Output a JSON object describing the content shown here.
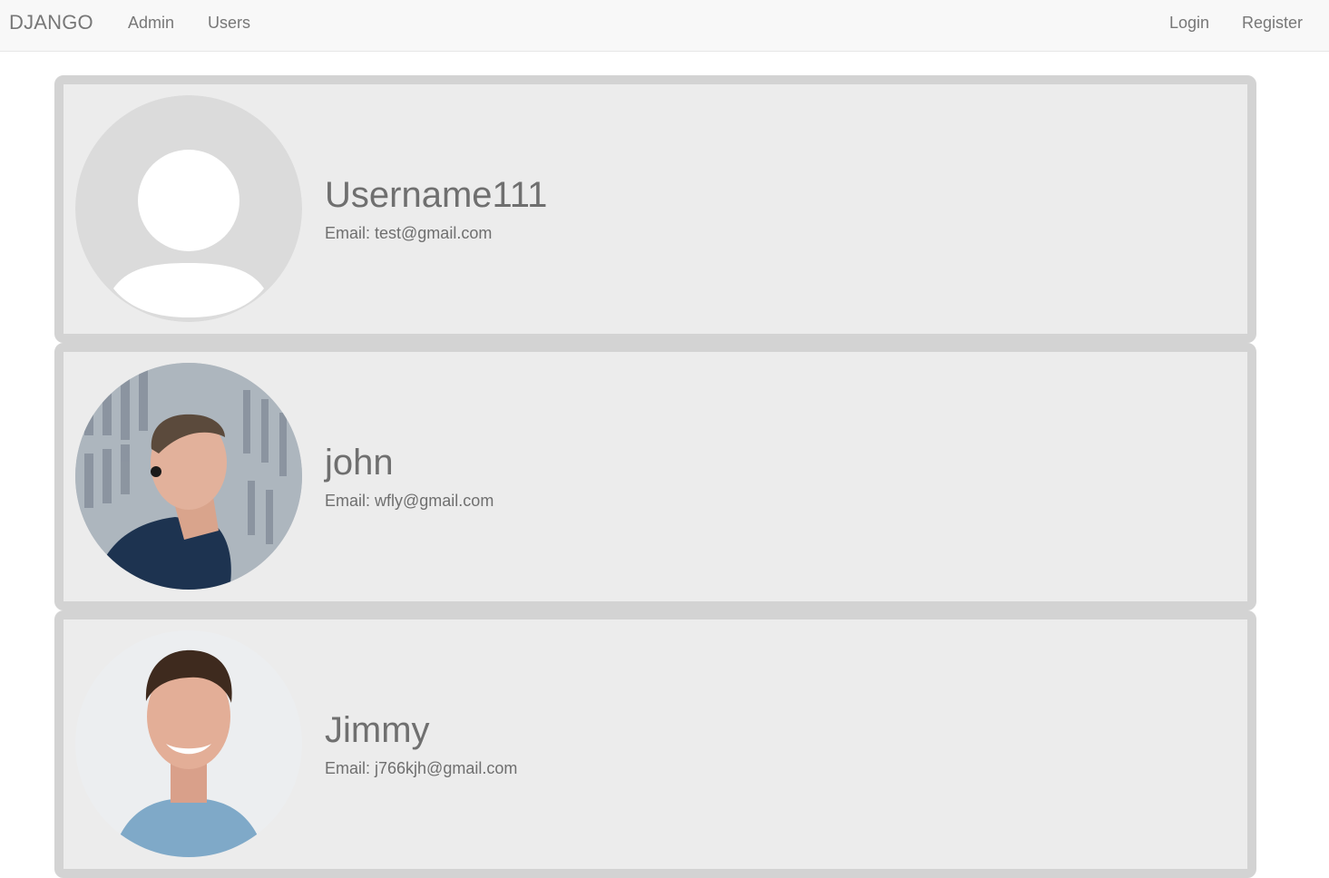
{
  "navbar": {
    "brand": "DJANGO",
    "links": [
      {
        "label": "Admin"
      },
      {
        "label": "Users"
      }
    ],
    "right_links": [
      {
        "label": "Login"
      },
      {
        "label": "Register"
      }
    ]
  },
  "users": [
    {
      "username": "Username111",
      "email_label": "Email:",
      "email": "test@gmail.com",
      "avatar": "default-avatar-icon"
    },
    {
      "username": "john",
      "email_label": "Email:",
      "email": "wfly@gmail.com",
      "avatar": "profile-photo"
    },
    {
      "username": "Jimmy",
      "email_label": "Email:",
      "email": "j766kjh@gmail.com",
      "avatar": "profile-photo"
    }
  ],
  "colors": {
    "navbar_bg": "#f8f8f8",
    "card_bg": "#ececec",
    "card_border": "#d3d3d3",
    "text": "#6f6f6f"
  }
}
